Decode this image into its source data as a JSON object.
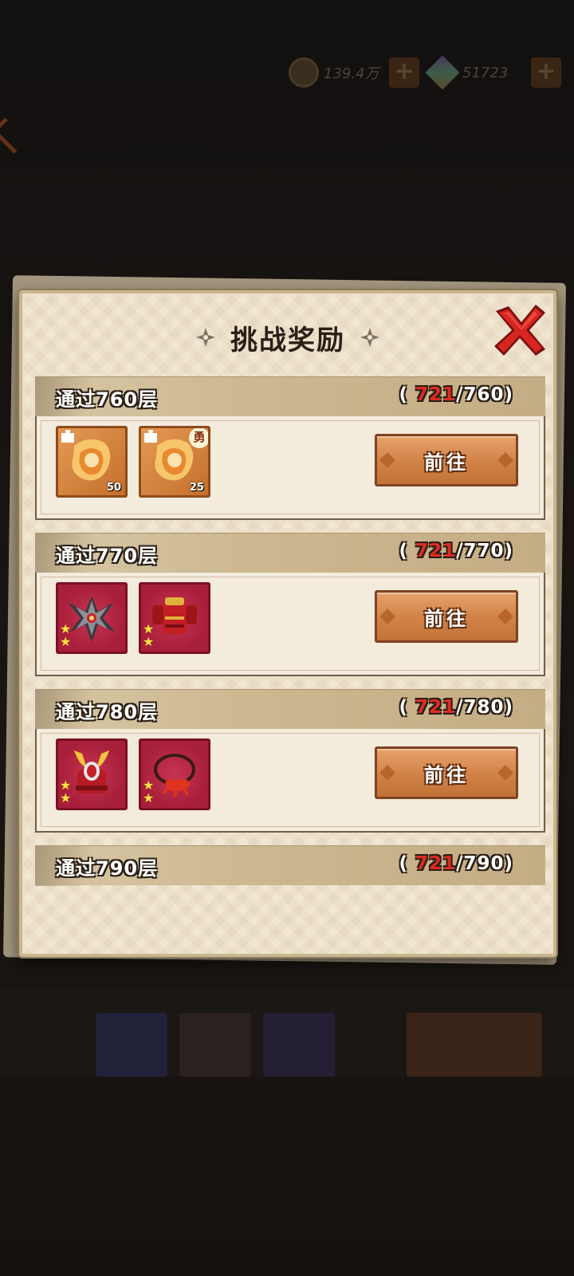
{
  "background": {
    "coins_value": "139.4万",
    "gems_value": "51723"
  },
  "panel": {
    "title": "挑战奖励",
    "close_label": "close"
  },
  "rewards": [
    {
      "title": "通过760层",
      "progress_current": "721",
      "progress_target": "/760)",
      "progress_open": "(",
      "button_label": "前往",
      "items": [
        {
          "icon": "orange-shard-icon",
          "qty": "50",
          "badge": ""
        },
        {
          "icon": "orange-shard-icon",
          "qty": "25",
          "badge": "勇"
        }
      ]
    },
    {
      "title": "通过770层",
      "progress_current": "721",
      "progress_target": "/770)",
      "progress_open": "(",
      "button_label": "前往",
      "items": [
        {
          "icon": "red-shuriken-weapon-icon",
          "stars": 2
        },
        {
          "icon": "red-armor-icon",
          "stars": 2
        }
      ]
    },
    {
      "title": "通过780层",
      "progress_current": "721",
      "progress_target": "/780)",
      "progress_open": "(",
      "button_label": "前往",
      "items": [
        {
          "icon": "red-helmet-icon",
          "stars": 2
        },
        {
          "icon": "red-necklace-icon",
          "stars": 2
        }
      ]
    },
    {
      "title": "通过790层",
      "progress_current": "721",
      "progress_target": "/790)",
      "progress_open": "("
    }
  ],
  "colors": {
    "progress_current": "#e02a22",
    "button": "#d08247",
    "panel": "#f1e6d2"
  }
}
